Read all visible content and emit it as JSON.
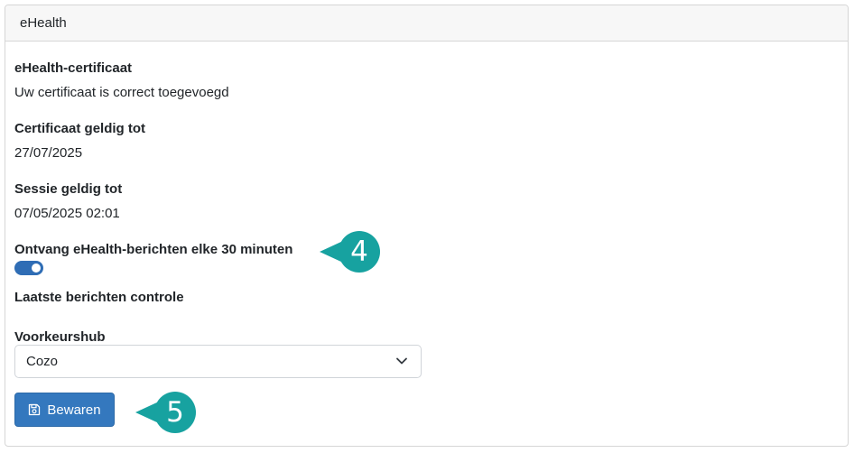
{
  "card": {
    "header_title": "eHealth"
  },
  "fields": {
    "certificate_label": "eHealth-certificaat",
    "certificate_value": "Uw certificaat is correct toegevoegd",
    "valid_until_label": "Certificaat geldig tot",
    "valid_until_value": "27/07/2025",
    "session_label": "Sessie geldig tot",
    "session_value": "07/05/2025 02:01",
    "receive_label": "Ontvang eHealth-berichten elke 30 minuten",
    "receive_toggle_on": true,
    "last_check_label": "Laatste berichten controle",
    "hub_label": "Voorkeurshub",
    "hub_selected": "Cozo"
  },
  "actions": {
    "save_label": "Bewaren",
    "save_icon": "floppy-disk-icon"
  },
  "callouts": [
    {
      "number": "4",
      "color": "#17a2a0"
    },
    {
      "number": "5",
      "color": "#17a2a0"
    }
  ],
  "colors": {
    "primary": "#3478be",
    "toggle": "#2f6db5",
    "callout": "#17a2a0"
  }
}
